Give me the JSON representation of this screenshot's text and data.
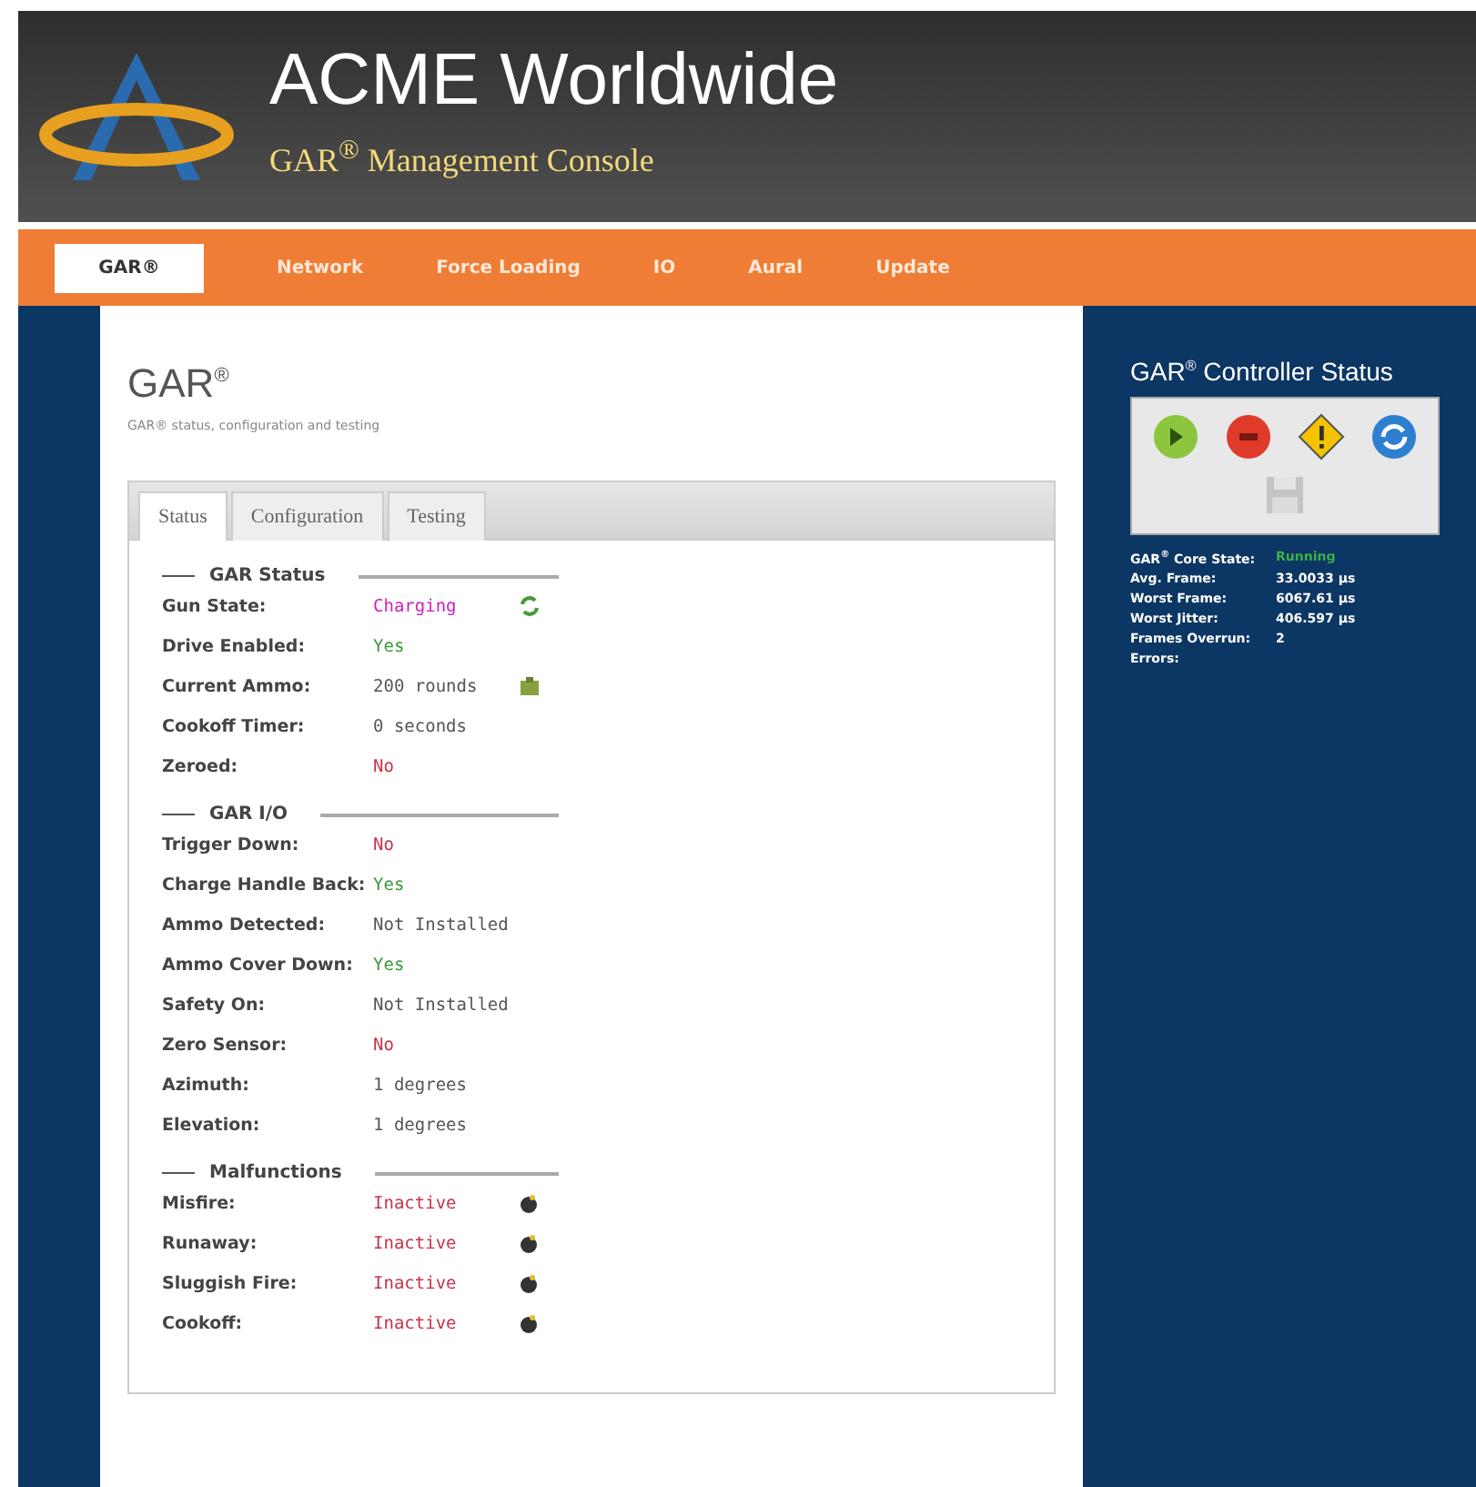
{
  "header": {
    "title": "ACME Worldwide",
    "subtitle": "GAR$^{®}$ Management Console"
  },
  "nav": [
    {
      "label": "GAR®",
      "selected": true
    },
    {
      "label": "Network",
      "selected": false
    },
    {
      "label": "Force Loading",
      "selected": false
    },
    {
      "label": "IO",
      "selected": false
    },
    {
      "label": "Aural",
      "selected": false
    },
    {
      "label": "Update",
      "selected": false
    }
  ],
  "page": {
    "title": "GAR$^{®}$",
    "subtitle": "GAR® status, configuration and testing"
  },
  "tabs": [
    {
      "label": "Status",
      "selected": true
    },
    {
      "label": "Configuration",
      "selected": false
    },
    {
      "label": "Testing",
      "selected": false
    }
  ],
  "sections": [
    {
      "title": "GAR Status",
      "rows": [
        {
          "kind": "refresh",
          "label": "Gun State:",
          "value": "Charging",
          "color": "#d020c0"
        },
        {
          "kind": "plain",
          "label": "Drive Enabled:",
          "value": "Yes",
          "color": "#3a9a3a"
        },
        {
          "kind": "ammo",
          "label": "Current Ammo:",
          "value": "200 rounds",
          "color": "#555555"
        },
        {
          "kind": "plain",
          "label": "Cookoff Timer:",
          "value": "0 seconds",
          "color": "#555555"
        },
        {
          "kind": "plain",
          "label": "Zeroed:",
          "value": "No",
          "color": "#c8334a"
        }
      ]
    },
    {
      "title": "GAR I/O",
      "rows": [
        {
          "kind": "plain",
          "label": "Trigger Down:",
          "value": "No",
          "color": "#c8334a"
        },
        {
          "kind": "plain",
          "label": "Charge Handle Back:",
          "value": "Yes",
          "color": "#3a9a3a"
        },
        {
          "kind": "plain",
          "label": "Ammo Detected:",
          "value": "Not Installed",
          "color": "#555555"
        },
        {
          "kind": "plain",
          "label": "Ammo Cover Down:",
          "value": "Yes",
          "color": "#3a9a3a"
        },
        {
          "kind": "plain",
          "label": "Safety On:",
          "value": "Not Installed",
          "color": "#555555"
        },
        {
          "kind": "plain",
          "label": "Zero Sensor:",
          "value": "No",
          "color": "#c8334a"
        },
        {
          "kind": "plain",
          "label": "Azimuth:",
          "value": "1 degrees",
          "color": "#555555"
        },
        {
          "kind": "plain",
          "label": "Elevation:",
          "value": "1 degrees",
          "color": "#555555"
        }
      ]
    },
    {
      "title": "Malfunctions",
      "rows": [
        {
          "kind": "bomb",
          "label": "Misfire:",
          "value": "Inactive",
          "color": "#c8334a"
        },
        {
          "kind": "bomb",
          "label": "Runaway:",
          "value": "Inactive",
          "color": "#c8334a"
        },
        {
          "kind": "bomb",
          "label": "Sluggish Fire:",
          "value": "Inactive",
          "color": "#c8334a"
        },
        {
          "kind": "bomb",
          "label": "Cookoff:",
          "value": "Inactive",
          "color": "#c8334a"
        }
      ]
    }
  ],
  "sidebar": {
    "title": "GAR$^{®}$ Controller Status",
    "buttons": [
      {
        "kind": "play"
      },
      {
        "kind": "stop"
      },
      {
        "kind": "warning"
      },
      {
        "kind": "refresh"
      },
      {
        "kind": "save",
        "disabled": true
      }
    ],
    "stats": [
      {
        "label": "GAR$^{®}$ Core State:",
        "value": "Running",
        "color": "#3ab04a"
      },
      {
        "label": "Avg. Frame:",
        "value": "33.0033 µs",
        "color": "#ffffff"
      },
      {
        "label": "Worst Frame:",
        "value": "6067.61 µs",
        "color": "#ffffff"
      },
      {
        "label": "Worst Jitter:",
        "value": "406.597 µs",
        "color": "#ffffff"
      },
      {
        "label": "Frames Overrun:",
        "value": "2",
        "color": "#ffffff"
      },
      {
        "label": "Errors:"
      }
    ]
  }
}
